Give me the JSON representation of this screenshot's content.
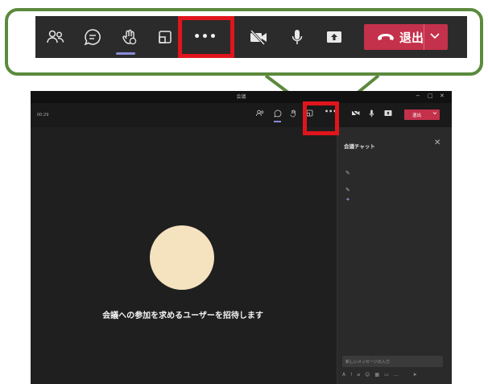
{
  "zoomed_toolbar": {
    "more_label": "•••",
    "leave_label": "退出"
  },
  "window": {
    "title": "会議",
    "timer": "00:29",
    "controls": {
      "minimize": "−",
      "maximize": "□",
      "close": "✕"
    },
    "toolbar": {
      "more_label": "•••",
      "leave_label": "退出"
    },
    "stage": {
      "invite_text": "会議への参加を求めるユーザーを招待します"
    },
    "chat_panel": {
      "title": "会議チャット",
      "close_label": "✕",
      "input_placeholder": "新しいメッセージの入力"
    }
  },
  "colors": {
    "callout_border": "#5b8a3c",
    "highlight_box": "#e0151c",
    "leave_button": "#c4314b",
    "active_underline": "#8b8cd8",
    "avatar": "#f5e3c0"
  },
  "icons": [
    "people-icon",
    "chat-icon",
    "raise-hand-icon",
    "share-tray-icon",
    "more-icon",
    "camera-off-icon",
    "microphone-icon",
    "share-screen-icon",
    "phone-hangup-icon",
    "chevron-down-icon"
  ]
}
